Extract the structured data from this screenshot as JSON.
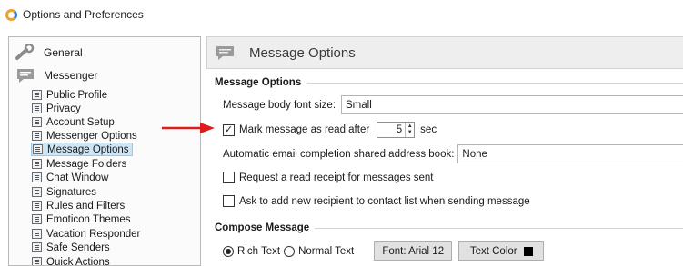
{
  "window": {
    "title": "Options and Preferences"
  },
  "sidebar": {
    "general": "General",
    "messenger": "Messenger",
    "items": [
      "Public Profile",
      "Privacy",
      "Account Setup",
      "Messenger Options",
      "Message Options",
      "Message Folders",
      "Chat Window",
      "Signatures",
      "Rules and Filters",
      "Emoticon Themes",
      "Vacation Responder",
      "Safe Senders",
      "Quick Actions"
    ],
    "selected": "Message Options"
  },
  "panel": {
    "title": "Message Options"
  },
  "message_options": {
    "heading": "Message Options",
    "font_size_label": "Message body font size:",
    "font_size_value": "Small",
    "mark_read_label": "Mark message as read after",
    "mark_read_checked": true,
    "mark_read_value": "5",
    "mark_read_unit": "sec",
    "autocomplete_label": "Automatic email completion shared address book:",
    "autocomplete_value": "None",
    "read_receipt_label": "Request a read receipt for messages sent",
    "add_recipient_label": "Ask to add new recipient to contact list when sending message"
  },
  "compose": {
    "heading": "Compose Message",
    "rich_text_label": "Rich Text",
    "normal_text_label": "Normal Text",
    "font_button": "Font: Arial 12",
    "text_color_button": "Text Color"
  },
  "colors": {
    "annotation_arrow": "#e01a1a",
    "selection": "#cde6f7"
  }
}
